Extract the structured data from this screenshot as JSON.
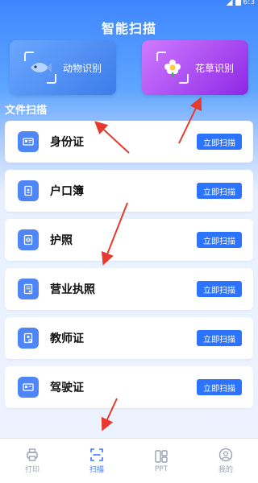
{
  "app": {
    "title": "智能扫描"
  },
  "status_bar": {
    "time": "6:3"
  },
  "features": [
    {
      "label": "动物识别",
      "icon": "fish-icon"
    },
    {
      "label": "花草识别",
      "icon": "flower-icon"
    }
  ],
  "section": {
    "title": "文件扫描"
  },
  "scan_items": [
    {
      "label": "身份证",
      "icon": "id-card-icon",
      "button": "立即扫描"
    },
    {
      "label": "户口簿",
      "icon": "household-register-icon",
      "button": "立即扫描"
    },
    {
      "label": "护照",
      "icon": "passport-icon",
      "button": "立即扫描"
    },
    {
      "label": "营业执照",
      "icon": "business-license-icon",
      "button": "立即扫描"
    },
    {
      "label": "教师证",
      "icon": "teacher-certificate-icon",
      "button": "立即扫描"
    },
    {
      "label": "驾驶证",
      "icon": "driver-license-icon",
      "button": "立即扫描"
    }
  ],
  "tabs": [
    {
      "label": "打印",
      "icon": "printer-icon"
    },
    {
      "label": "扫描",
      "icon": "scan-icon",
      "active": true
    },
    {
      "label": "PPT",
      "icon": "ppt-icon"
    },
    {
      "label": "我的",
      "icon": "profile-icon"
    }
  ],
  "colors": {
    "accent": "#2c74ff",
    "annotation": "#e53b2e"
  }
}
